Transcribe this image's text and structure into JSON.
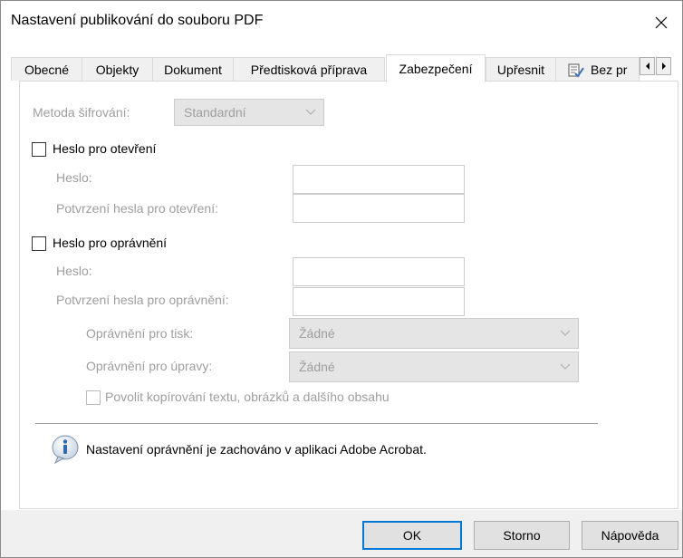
{
  "window": {
    "title": "Nastavení publikování do souboru PDF"
  },
  "tabs": [
    {
      "label": "Obecné"
    },
    {
      "label": "Objekty"
    },
    {
      "label": "Dokument"
    },
    {
      "label": "Předtisková příprava"
    },
    {
      "label": "Zabezpečení"
    },
    {
      "label": "Upřesnit"
    },
    {
      "label": "Bez pr"
    }
  ],
  "active_tab": "Zabezpečení",
  "security": {
    "encryption_label": "Metoda šifrování:",
    "encryption_value": "Standardní",
    "open_password_checkbox": "Heslo pro otevření",
    "open_password_label": "Heslo:",
    "open_password_value": "",
    "open_confirm_label": "Potvrzení hesla pro otevření:",
    "open_confirm_value": "",
    "perm_password_checkbox": "Heslo pro oprávnění",
    "perm_password_label": "Heslo:",
    "perm_password_value": "",
    "perm_confirm_label": "Potvrzení hesla pro oprávnění:",
    "perm_confirm_value": "",
    "print_perm_label": "Oprávnění pro tisk:",
    "print_perm_value": "Žádné",
    "edit_perm_label": "Oprávnění pro úpravy:",
    "edit_perm_value": "Žádné",
    "copy_checkbox": "Povolit kopírování textu, obrázků a dalšího obsahu",
    "info_text": "Nastavení oprávnění je zachováno v aplikaci Adobe Acrobat."
  },
  "buttons": {
    "ok": "OK",
    "cancel": "Storno",
    "help": "Nápověda"
  },
  "colors": {
    "focus": "#0078d7",
    "disabled_text": "#9e9e9e",
    "info_icon": "#2b6cb0"
  },
  "icons": [
    "close-icon",
    "info-icon",
    "tab-scroll-left-icon",
    "tab-scroll-right-icon",
    "accessibility-tab-icon",
    "chevron-down-icon"
  ]
}
